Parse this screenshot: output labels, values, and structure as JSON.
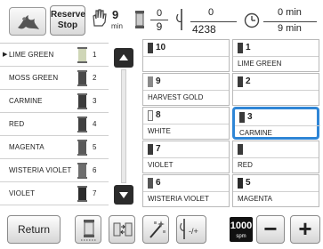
{
  "toolbar": {
    "reserve_stop_line1": "Reserve",
    "reserve_stop_line2": "Stop",
    "color_changes": "9",
    "color_changes_unit": "min",
    "color_current": "0",
    "color_total": "9",
    "stitch_current": "0",
    "stitch_total": "4238",
    "time_current": "0 min",
    "time_total": "9 min"
  },
  "color_list": [
    {
      "name": "LIME GREEN",
      "index": "1",
      "color": "#cfd6b7",
      "active": true
    },
    {
      "name": "MOSS GREEN",
      "index": "2",
      "color": "#4a4a4a",
      "active": false
    },
    {
      "name": "CARMINE",
      "index": "3",
      "color": "#3c3c3c",
      "active": false
    },
    {
      "name": "RED",
      "index": "4",
      "color": "#404040",
      "active": false
    },
    {
      "name": "MAGENTA",
      "index": "5",
      "color": "#5a5a5a",
      "active": false
    },
    {
      "name": "WISTERIA VIOLET",
      "index": "6",
      "color": "#6e6e6e",
      "active": false
    },
    {
      "name": "VIOLET",
      "index": "7",
      "color": "#2c2c2c",
      "active": false
    }
  ],
  "grid": {
    "left": [
      {
        "no": "10",
        "name": "",
        "color": "#3a3a3a"
      },
      {
        "no": "9",
        "name": "HARVEST GOLD",
        "color": "#8a8a8a"
      },
      {
        "no": "8",
        "name": "WHITE",
        "color": "#f4f4f4"
      },
      {
        "no": "7",
        "name": "VIOLET",
        "color": "#3a3a3a"
      },
      {
        "no": "6",
        "name": "WISTERIA VIOLET",
        "color": "#555555"
      }
    ],
    "right": [
      {
        "no": "1",
        "name": "LIME GREEN",
        "color": "#3a3a3a"
      },
      {
        "no": "2",
        "name": "",
        "color": "#3a3a3a"
      },
      {
        "no": "3",
        "name": "CARMINE",
        "color": "#3a3a3a"
      },
      {
        "no": "",
        "name": "RED",
        "color": "#3a3a3a"
      },
      {
        "no": "5",
        "name": "MAGENTA",
        "color": "#2a2a2a"
      }
    ]
  },
  "bottom": {
    "return_label": "Return",
    "speed_value": "1000",
    "speed_unit": "spm",
    "minus_label": "−",
    "plus_label": "+"
  },
  "colors": {
    "selection": "#2f86d6"
  }
}
